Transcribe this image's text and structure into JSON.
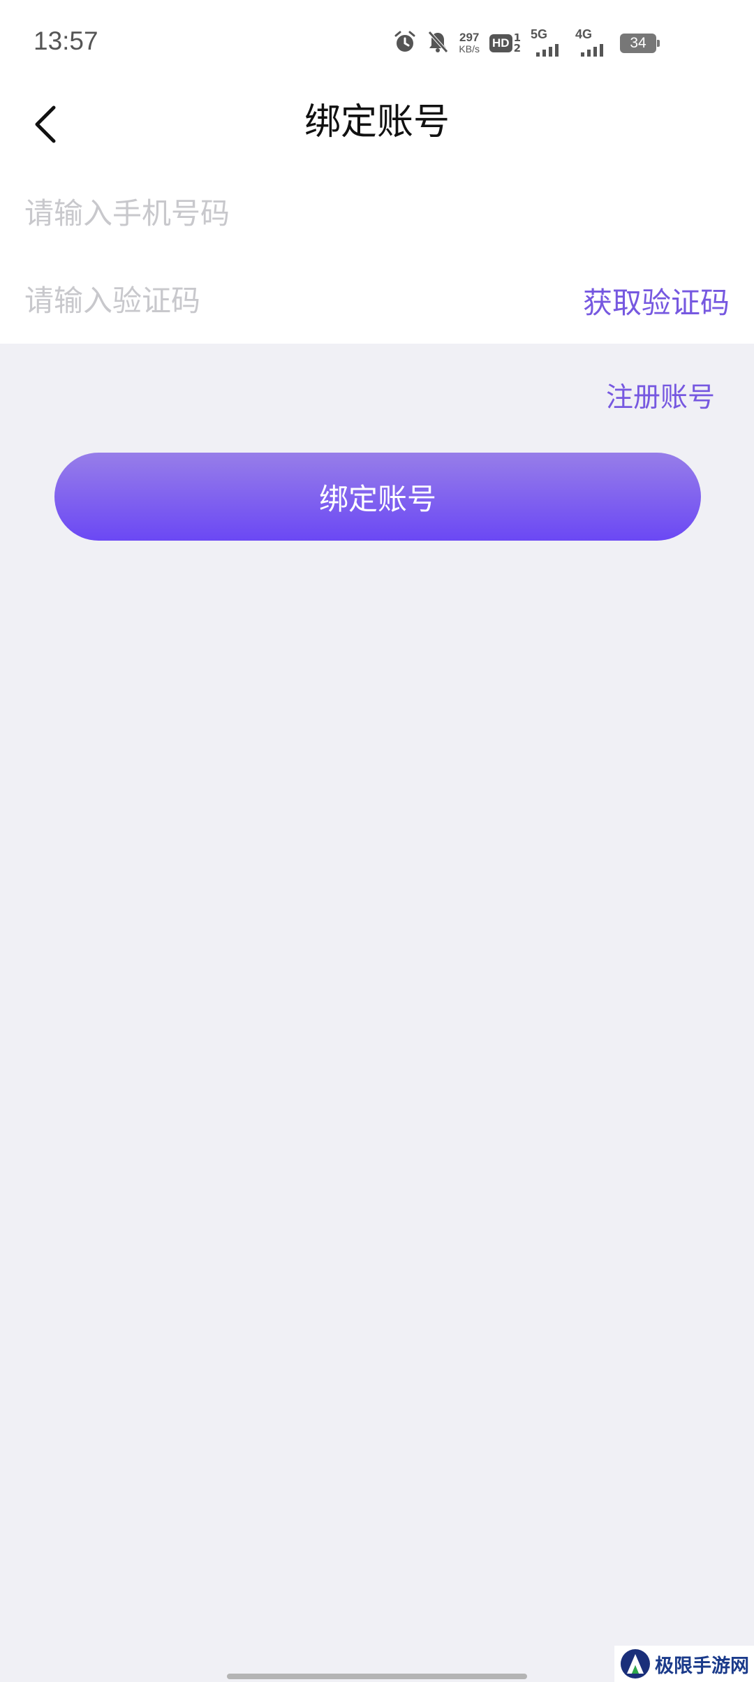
{
  "status_bar": {
    "time": "13:57",
    "net_speed_value": "297",
    "net_speed_unit": "KB/s",
    "hd_label": "HD",
    "hd_sim_top": "1",
    "hd_sim_bottom": "2",
    "network_1": "5G",
    "network_2": "4G",
    "battery": "34",
    "icons": [
      "alarm-icon",
      "mute-bell-icon"
    ]
  },
  "header": {
    "title": "绑定账号",
    "back_icon": "chevron-left-icon"
  },
  "form": {
    "phone_placeholder": "请输入手机号码",
    "phone_value": "",
    "code_placeholder": "请输入验证码",
    "code_value": "",
    "get_code_label": "获取验证码"
  },
  "actions": {
    "register_label": "注册账号",
    "bind_label": "绑定账号"
  },
  "watermark": {
    "text": "极限手游网"
  },
  "colors": {
    "accent": "#7658e0",
    "button_top": "#977ee9",
    "button_bottom": "#6b48f4",
    "background": "#f0f0f5"
  }
}
